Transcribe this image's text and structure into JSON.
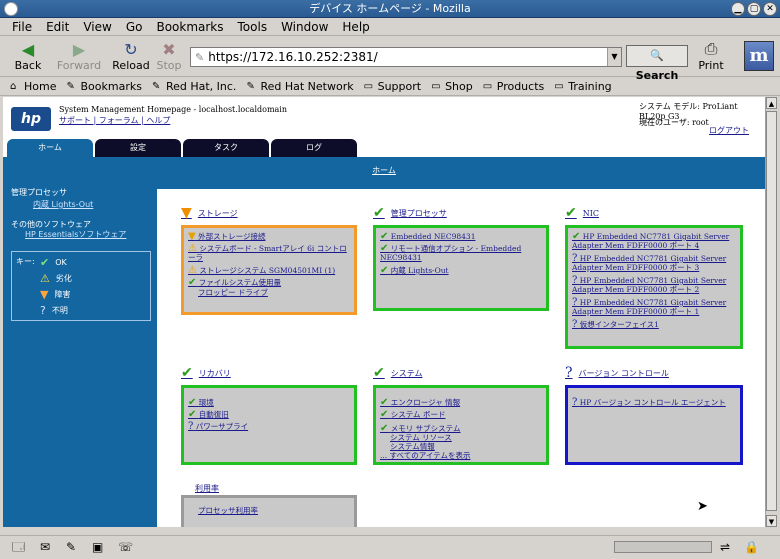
{
  "window": {
    "title": "デバイス ホームページ - Mozilla"
  },
  "menu": [
    "File",
    "Edit",
    "View",
    "Go",
    "Bookmarks",
    "Tools",
    "Window",
    "Help"
  ],
  "nav": {
    "back": "Back",
    "forward": "Forward",
    "reload": "Reload",
    "stop": "Stop",
    "print": "Print",
    "search": "Search"
  },
  "url": "https://172.16.10.252:2381/",
  "personal": [
    "Home",
    "Bookmarks",
    "Red Hat, Inc.",
    "Red Hat Network",
    "Support",
    "Shop",
    "Products",
    "Training"
  ],
  "hp": {
    "logo": "hp",
    "title": "System Management Homepage - localhost.localdomain",
    "links": "サポート | フォーラム | ヘルプ",
    "model_label": "システム モデル: ProLiant BL20p G3",
    "user_label": "現在のユーザ:  root",
    "logout": "ログアウト"
  },
  "tabs": [
    "ホーム",
    "設定",
    "タスク",
    "ログ"
  ],
  "bluebar": "ホーム",
  "sidebar": {
    "s1": "管理プロセッサ",
    "s1_link": "内蔵 Lights-Out",
    "s2": "その他のソフトウェア",
    "s2_link": "HP Essentialsソフトウェア",
    "key_label": "キー:",
    "key_items": [
      "OK",
      "劣化",
      "障害",
      "不明"
    ]
  },
  "groups": {
    "storage": {
      "title": "ストレージ",
      "items": [
        "外部ストレージ接続",
        "システムボード - Smartアレイ 6i コントローラ",
        "ストレージシステム SGM04501MI (1)",
        "ファイルシステム使用量",
        "フロッピー ドライブ"
      ]
    },
    "mgmt": {
      "title": "管理プロセッサ",
      "items": [
        "Embedded NEC98431",
        "リモート通信オプション - Embedded NEC98431",
        "内蔵 Lights-Out"
      ]
    },
    "nic": {
      "title": "NIC",
      "items": [
        "HP Embedded NC7781 Gigabit Server Adapter Mem FDFF0000 ポート 4",
        "HP Embedded NC7781 Gigabit Server Adapter Mem FDFF0000 ポート 3",
        "HP Embedded NC7781 Gigabit Server Adapter Mem FDFF0000 ポート 2",
        "HP Embedded NC7781 Gigabit Server Adapter Mem FDFF0000 ポート 1",
        "仮想インターフェイス1"
      ]
    },
    "recovery": {
      "title": "リカバリ",
      "items": [
        "環境",
        "自動復旧",
        "パワーサプライ"
      ]
    },
    "system": {
      "title": "システム",
      "items": [
        "エンクロージャ 情報",
        "システム ボード",
        "メモリ サブシステム",
        "システム リソース",
        "システム情報",
        "... すべてのアイテムを表示"
      ]
    },
    "version": {
      "title": "バージョン コントロール",
      "items": [
        "HP バージョン コントロール エージェント"
      ]
    },
    "util": {
      "title": "利用率",
      "items": [
        "プロセッサ利用率"
      ]
    }
  },
  "colors": {
    "ok": "#2a9a1a",
    "warn": "#e8a000",
    "fail": "#f08c00",
    "unknown": "#1a2aa0",
    "blue_band": "#1366a0"
  }
}
